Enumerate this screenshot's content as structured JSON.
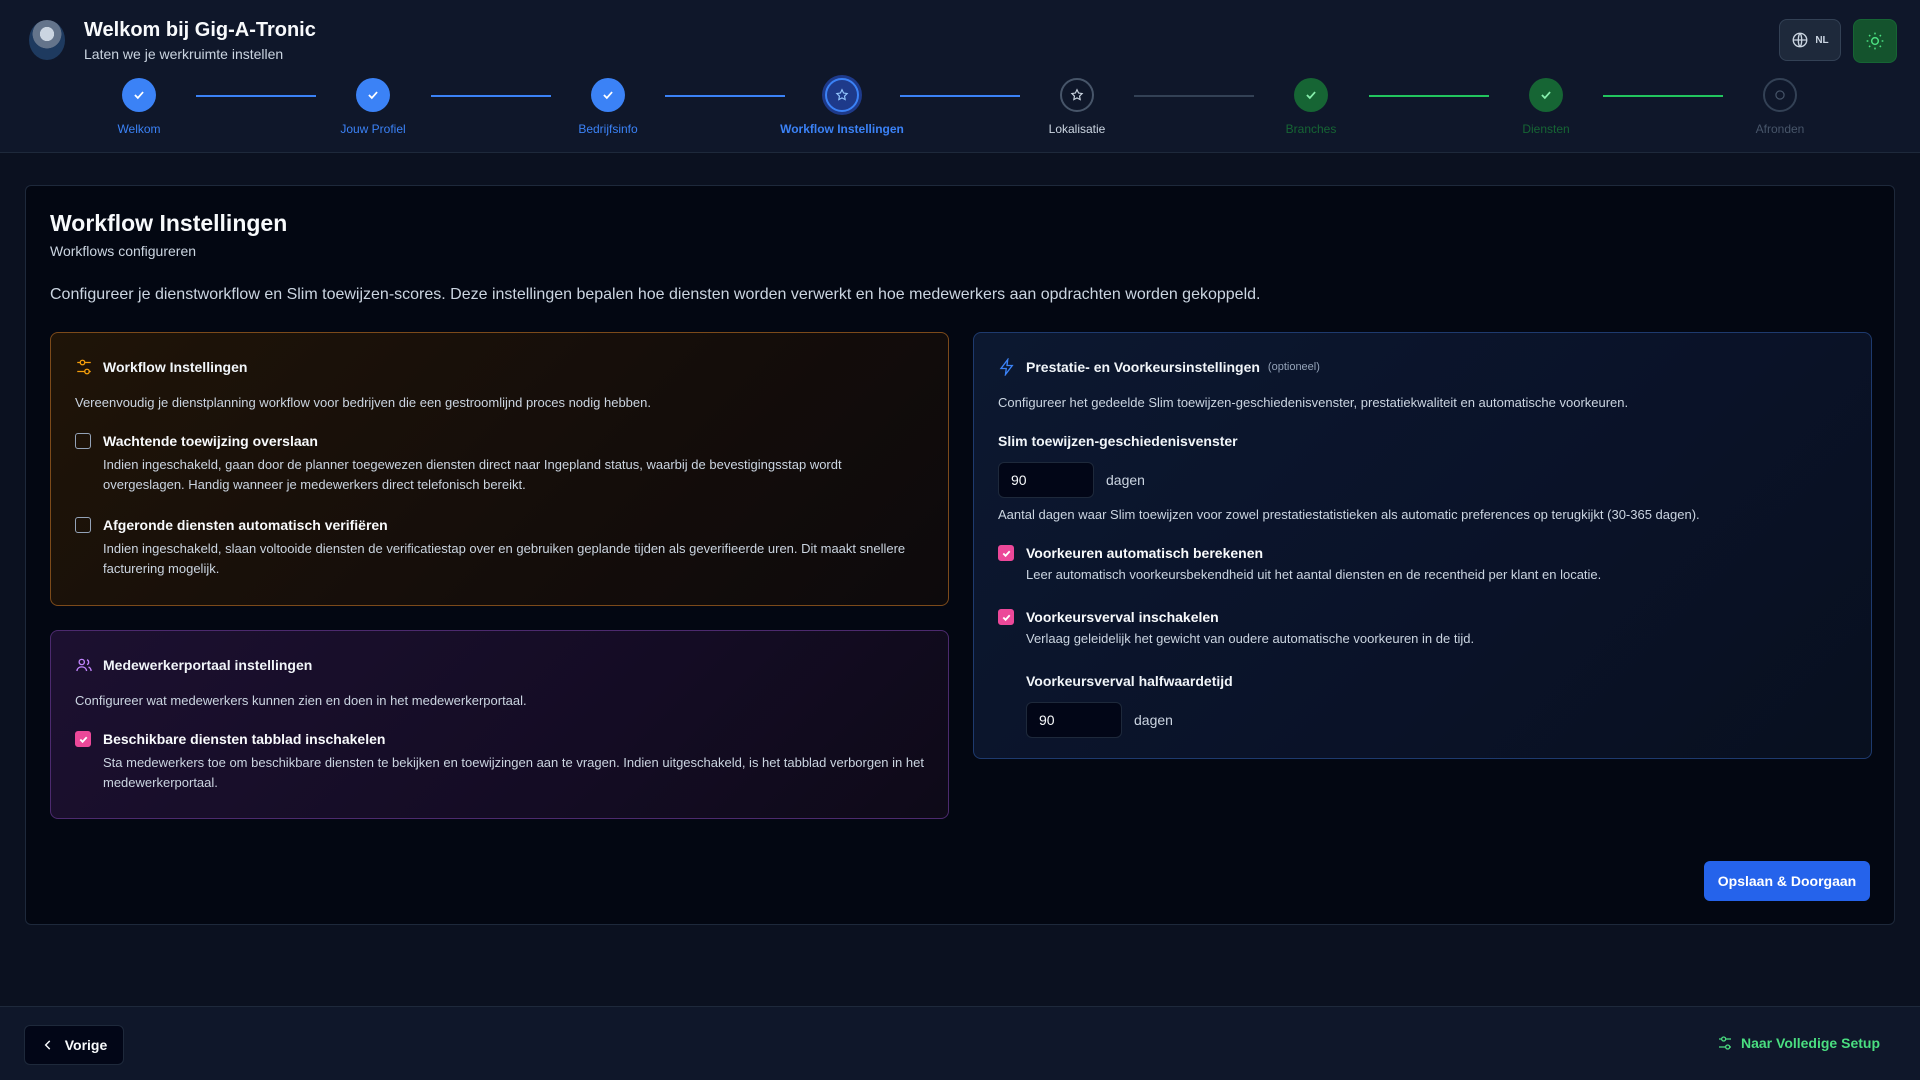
{
  "header": {
    "title": "Welkom bij Gig-A-Tronic",
    "subtitle": "Laten we je werkruimte instellen",
    "lang_label": "NL"
  },
  "stepper": {
    "steps": [
      {
        "label": "Welkom",
        "state": "done"
      },
      {
        "label": "Jouw Profiel",
        "state": "done"
      },
      {
        "label": "Bedrijfsinfo",
        "state": "done"
      },
      {
        "label": "Workflow Instellingen",
        "state": "current"
      },
      {
        "label": "Lokalisatie",
        "state": "pending"
      },
      {
        "label": "Branches",
        "state": "done-green"
      },
      {
        "label": "Diensten",
        "state": "done-green"
      },
      {
        "label": "Afronden",
        "state": "todo"
      }
    ]
  },
  "main": {
    "title": "Workflow Instellingen",
    "subtitle": "Workflows configureren",
    "description": "Configureer je dienstworkflow en Slim toewijzen-scores. Deze instellingen bepalen hoe diensten worden verwerkt en hoe medewerkers aan opdrachten worden gekoppeld.",
    "workflow_panel": {
      "title": "Workflow Instellingen",
      "description": "Vereenvoudig je dienstplanning workflow voor bedrijven die een gestroomlijnd proces nodig hebben.",
      "options": [
        {
          "title": "Wachtende toewijzing overslaan",
          "description": "Indien ingeschakeld, gaan door de planner toegewezen diensten direct naar Ingepland status, waarbij de bevestigingsstap wordt overgeslagen. Handig wanneer je medewerkers direct telefonisch bereikt.",
          "checked": false
        },
        {
          "title": "Afgeronde diensten automatisch verifiëren",
          "description": "Indien ingeschakeld, slaan voltooide diensten de verificatiestap over en gebruiken geplande tijden als geverifieerde uren. Dit maakt snellere facturering mogelijk.",
          "checked": false
        }
      ]
    },
    "portal_panel": {
      "title": "Medewerkerportaal instellingen",
      "description": "Configureer wat medewerkers kunnen zien en doen in het medewerkerportaal.",
      "options": [
        {
          "title": "Beschikbare diensten tabblad inschakelen",
          "description": "Sta medewerkers toe om beschikbare diensten te bekijken en toewijzingen aan te vragen. Indien uitgeschakeld, is het tabblad verborgen in het medewerkerportaal.",
          "checked": true
        }
      ]
    },
    "performance_panel": {
      "title": "Prestatie- en Voorkeursinstellingen",
      "optional_label": "(optioneel)",
      "description": "Configureer het gedeelde Slim toewijzen-geschiedenisvenster, prestatiekwaliteit en automatische voorkeuren.",
      "history_label": "Slim toewijzen-geschiedenisvenster",
      "history_value": "90",
      "history_unit": "dagen",
      "history_help": "Aantal dagen waar Slim toewijzen voor zowel prestatiestatistieken als automatic preferences op terugkijkt (30-365 dagen).",
      "options": [
        {
          "title": "Voorkeuren automatisch berekenen",
          "description": "Leer automatisch voorkeursbekendheid uit het aantal diensten en de recentheid per klant en locatie.",
          "checked": true
        },
        {
          "title": "Voorkeursverval inschakelen",
          "description": "Verlaag geleidelijk het gewicht van oudere automatische voorkeuren in de tijd.",
          "checked": true
        }
      ],
      "halflife_label": "Voorkeursverval halfwaardetijd",
      "halflife_value": "90",
      "halflife_unit": "dagen"
    },
    "save_label": "Opslaan & Doorgaan"
  },
  "footer": {
    "prev_label": "Vorige",
    "setup_link": "Naar Volledige Setup"
  },
  "colors": {
    "accent_blue": "#3b82f6",
    "accent_green": "#22c55e",
    "accent_pink": "#ec4899",
    "accent_orange": "#f59e0b",
    "accent_purple": "#c084fc"
  }
}
